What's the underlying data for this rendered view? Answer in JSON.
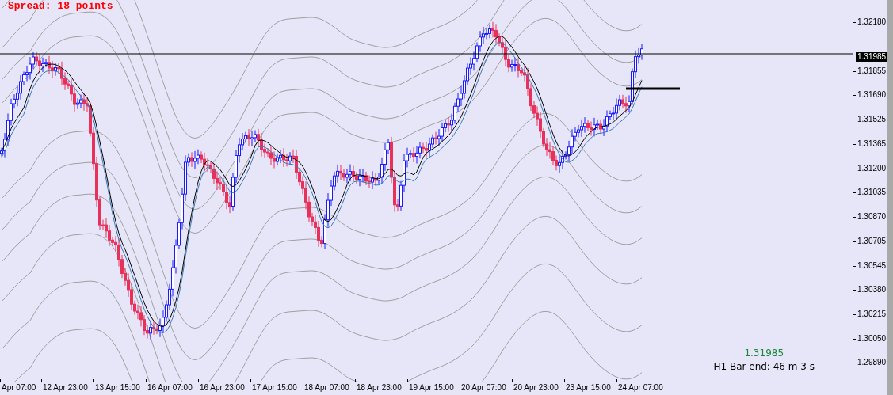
{
  "spread_label": "Spread: 18 points",
  "price_axis": {
    "labels": [
      "1.32180",
      "1.31855",
      "1.31690",
      "1.31525",
      "1.31365",
      "1.31200",
      "1.31035",
      "1.30870",
      "1.30705",
      "1.30545",
      "1.30380",
      "1.30215",
      "1.30050",
      "1.29890"
    ],
    "bid_label": "1.31985"
  },
  "time_axis": {
    "labels": [
      "Apr 07:00",
      "12 Apr 23:00",
      "13 Apr 15:00",
      "16 Apr 07:00",
      "16 Apr 23:00",
      "17 Apr 15:00",
      "18 Apr 07:00",
      "18 Apr 23:00",
      "19 Apr 15:00",
      "20 Apr 07:00",
      "20 Apr 23:00",
      "23 Apr 15:00",
      "24 Apr 07:00"
    ]
  },
  "info": {
    "price": "1.31985",
    "bar_end": "H1 Bar end: 46 m 3 s"
  }
}
